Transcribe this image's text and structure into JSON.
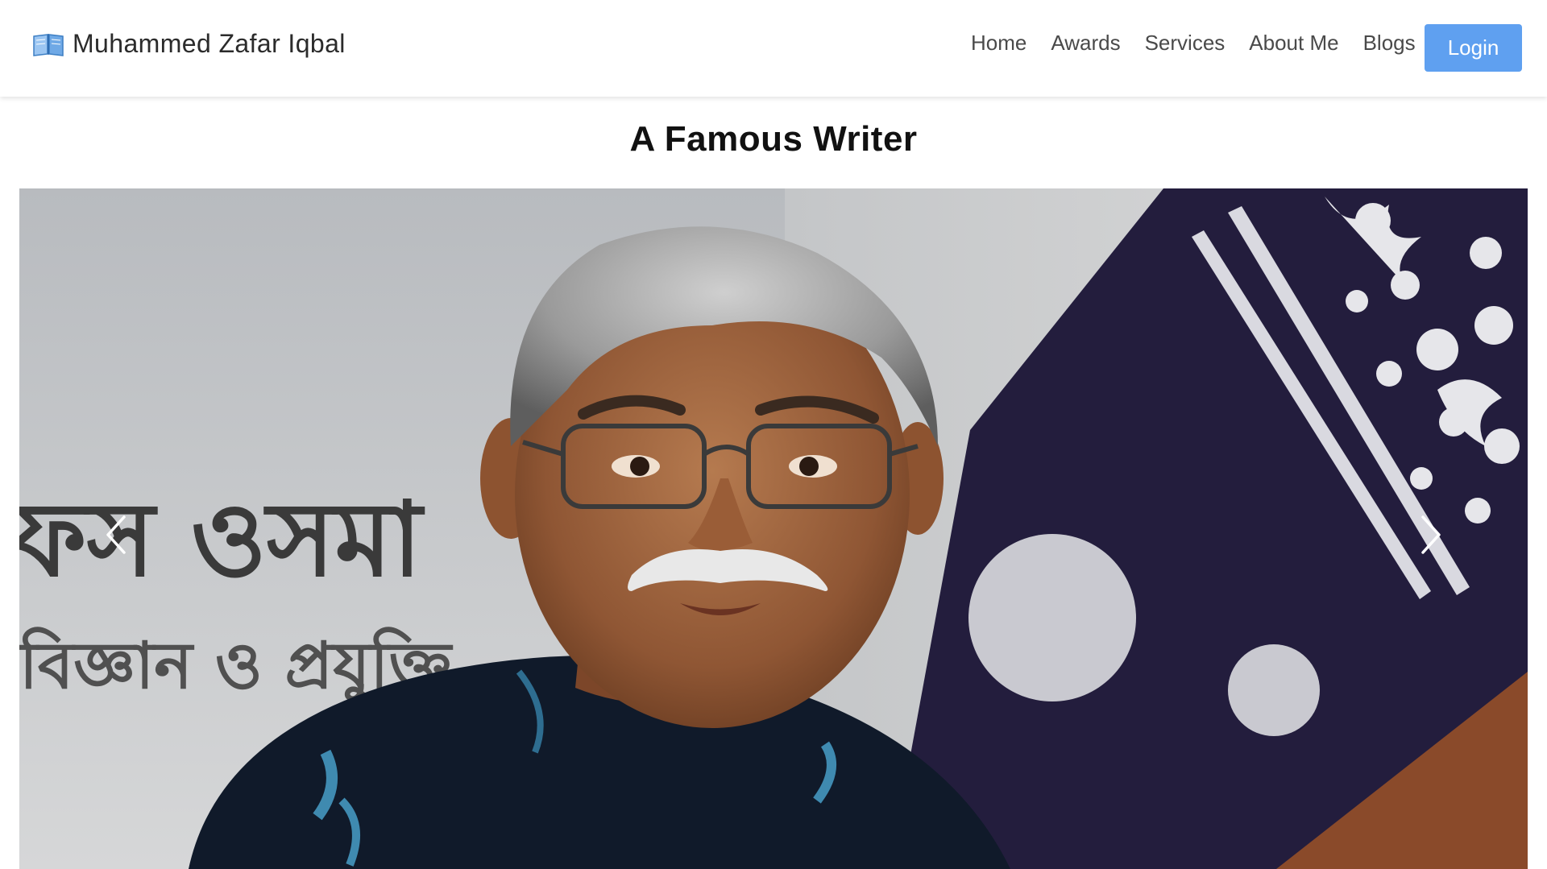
{
  "brand": {
    "name": "Muhammed Zafar Iqbal",
    "icon": "open-book-icon"
  },
  "nav": {
    "links": [
      {
        "label": "Home"
      },
      {
        "label": "Awards"
      },
      {
        "label": "Services"
      },
      {
        "label": "About Me"
      },
      {
        "label": "Blogs"
      }
    ],
    "login_label": "Login"
  },
  "colors": {
    "accent": "#5fa0f0",
    "background": "#ffffff",
    "title": "#111111"
  },
  "main": {
    "title": "A Famous Writer"
  },
  "carousel": {
    "prev_icon": "chevron-left-icon",
    "next_icon": "chevron-right-icon",
    "background_text_line1": "ফস ওসমা",
    "background_text_line2": "বিজ্ঞান ও প্রযুক্তি"
  }
}
